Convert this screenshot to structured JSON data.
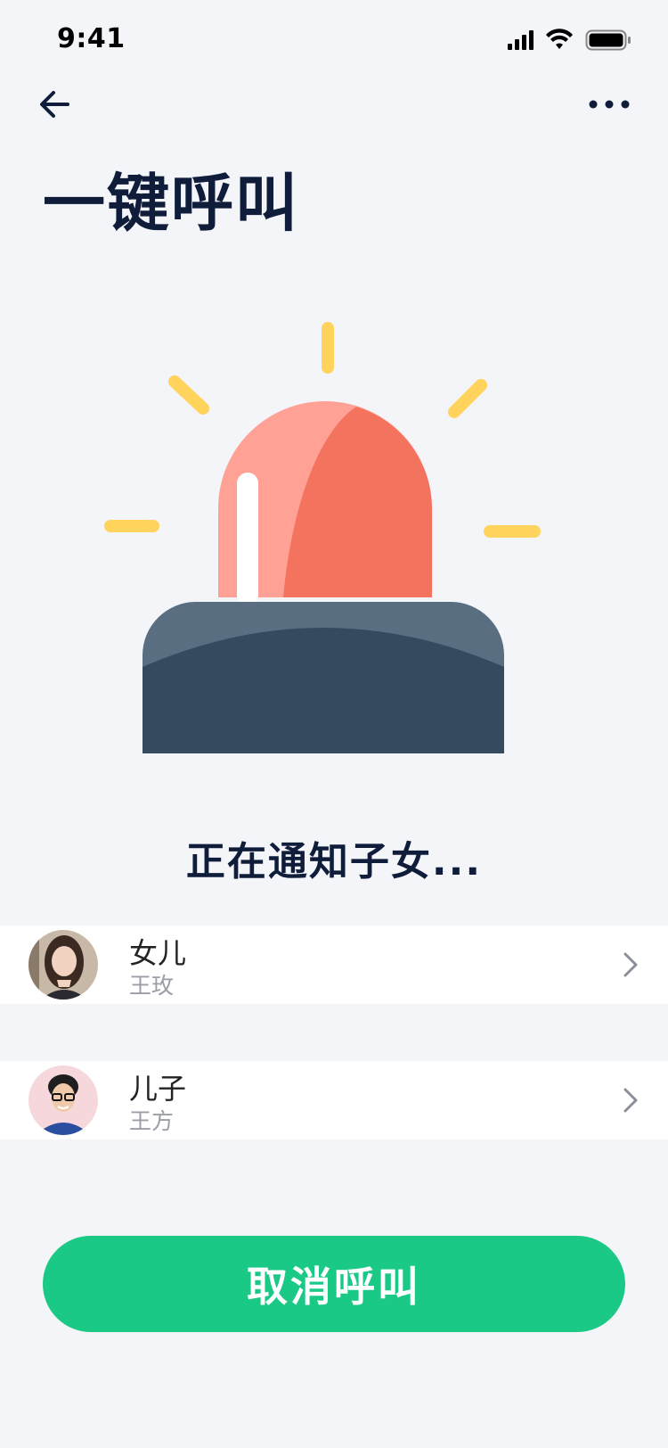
{
  "status_bar": {
    "time": "9:41"
  },
  "nav": {
    "back_icon": "arrow-left-icon",
    "more_icon": "more-horizontal-icon"
  },
  "title": "一键呼叫",
  "alarm_icon": "siren-icon",
  "status_message": "正在通知子女...",
  "contacts": [
    {
      "relation": "女儿",
      "name": "王玫",
      "avatar": "avatar-daughter"
    },
    {
      "relation": "儿子",
      "name": "王方",
      "avatar": "avatar-son"
    }
  ],
  "cancel_label": "取消呼叫",
  "colors": {
    "background": "#f4f5f9",
    "accent": "#19c985",
    "title": "#0f1d3a",
    "siren_red": "#f3735e",
    "siren_light": "#ffa295",
    "siren_base": "#344a5f",
    "rays": "#ffd35c"
  }
}
